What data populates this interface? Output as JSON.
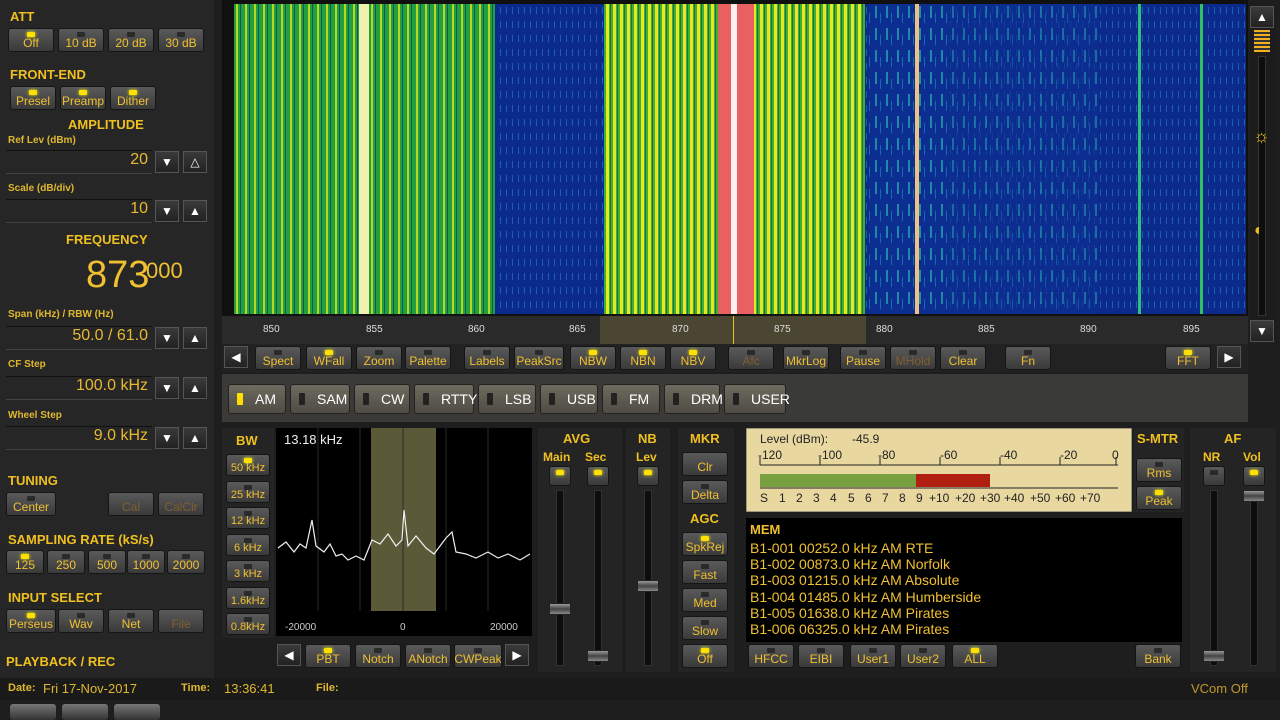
{
  "att": {
    "title": "ATT",
    "buttons": [
      "Off",
      "10 dB",
      "20 dB",
      "30 dB"
    ]
  },
  "frontend": {
    "title": "FRONT-END",
    "buttons": [
      "Presel",
      "Preamp",
      "Dither"
    ]
  },
  "amplitude": {
    "title": "AMPLITUDE",
    "ref_label": "Ref Lev (dBm)",
    "ref_value": "20",
    "scale_label": "Scale (dB/div)",
    "scale_value": "10"
  },
  "frequency": {
    "title": "FREQUENCY",
    "main": "873",
    "sub": "000",
    "span_label": "Span (kHz) / RBW (Hz)",
    "span_value": "50.0 / 61.0",
    "cfstep_label": "CF Step",
    "cfstep_value": "100.0 kHz",
    "wheel_label": "Wheel Step",
    "wheel_value": "9.0 kHz"
  },
  "tuning": {
    "title": "TUNING",
    "buttons": [
      "Center",
      "Cal",
      "CalClr"
    ]
  },
  "sampling": {
    "title": "SAMPLING RATE (kS/s)",
    "buttons": [
      "125",
      "250",
      "500",
      "1000",
      "2000"
    ]
  },
  "input": {
    "title": "INPUT SELECT",
    "buttons": [
      "Perseus",
      "Wav",
      "Net",
      "File"
    ]
  },
  "playback": {
    "title": "PLAYBACK / REC"
  },
  "status": {
    "date_label": "Date:",
    "date": "Fri 17-Nov-2017",
    "time_label": "Time:",
    "time": "13:36:41",
    "file_label": "File:",
    "vcom": "VCom Off"
  },
  "axis_ticks": [
    "850",
    "855",
    "860",
    "865",
    "870",
    "875",
    "880",
    "885",
    "890",
    "895"
  ],
  "toolbar": [
    "Spect",
    "WFall",
    "Zoom",
    "Palette",
    "Labels",
    "PeakSrc",
    "NBW",
    "NBN",
    "NBV",
    "Afc",
    "MkrLog",
    "Pause",
    "MHold",
    "Clear",
    "Fn",
    "FFT"
  ],
  "modes": [
    "AM",
    "SAM",
    "CW",
    "RTTY",
    "LSB",
    "USB",
    "FM",
    "DRM",
    "USER"
  ],
  "bw": {
    "title": "BW",
    "buttons": [
      "50 kHz",
      "25 kHz",
      "12 kHz",
      "6 kHz",
      "3 kHz",
      "1.6kHz",
      "0.8kHz"
    ],
    "readout": "13.18 kHz",
    "ticks": [
      "-20000",
      "0",
      "20000"
    ]
  },
  "filter_buttons": [
    "PBT",
    "Notch",
    "ANotch",
    "CWPeak"
  ],
  "avg": {
    "title": "AVG",
    "main": "Main",
    "sec": "Sec"
  },
  "nb": {
    "title": "NB",
    "lev": "Lev"
  },
  "mkr": {
    "title": "MKR",
    "buttons": [
      "Clr",
      "Delta"
    ]
  },
  "agc": {
    "title": "AGC",
    "buttons": [
      "SpkRej",
      "Fast",
      "Med",
      "Slow",
      "Off"
    ]
  },
  "smeter": {
    "level_label": "Level (dBm):",
    "level_value": "-45.9",
    "top_scale": [
      "-120",
      "-100",
      "-80",
      "-60",
      "-40",
      "-20",
      "0"
    ],
    "bottom_scale": [
      "S",
      "1",
      "2",
      "3",
      "4",
      "5",
      "6",
      "7",
      "8",
      "9",
      "+10",
      "+20",
      "+30",
      "+40",
      "+50",
      "+60",
      "+70"
    ],
    "title": "S-MTR",
    "buttons": [
      "Rms",
      "Peak"
    ]
  },
  "af": {
    "title": "AF",
    "nr": "NR",
    "vol": "Vol"
  },
  "memory": {
    "title": "MEM",
    "rows": [
      "B1-001 00252.0 kHz  AM  RTE",
      "B1-002 00873.0 kHz  AM  Norfolk",
      "B1-003 01215.0 kHz  AM  Absolute",
      "B1-004 01485.0 kHz  AM  Humberside",
      "B1-005 01638.0 kHz  AM  Pirates",
      "B1-006 06325.0 kHz  AM  Pirates"
    ],
    "buttons": [
      "HFCC",
      "EIBI",
      "User1",
      "User2",
      "ALL",
      "Bank"
    ]
  },
  "colors": {
    "accent": "#f0c020",
    "waterfall_bg": "#0a2a8a",
    "passband": "#6a6a3a"
  }
}
